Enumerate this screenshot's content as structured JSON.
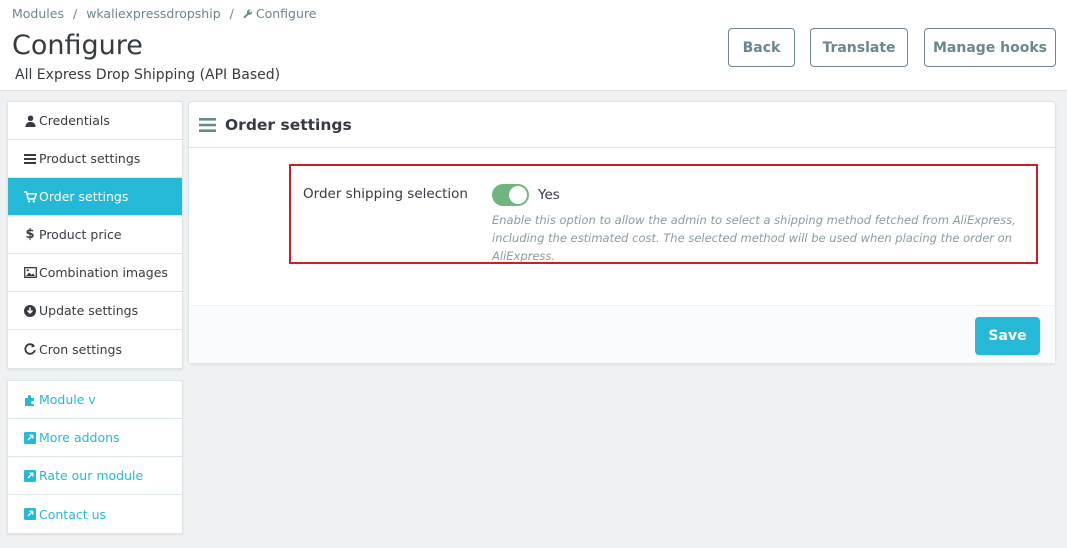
{
  "breadcrumb": {
    "items": [
      "Modules",
      "wkaliexpressdropship",
      "Configure"
    ],
    "separator": "/"
  },
  "page": {
    "title": "Configure",
    "subtitle": "All Express Drop Shipping (API Based)"
  },
  "header_buttons": {
    "back": "Back",
    "translate": "Translate",
    "manage_hooks": "Manage hooks"
  },
  "sidebar": {
    "items": [
      {
        "label": "Credentials",
        "icon": "user-icon"
      },
      {
        "label": "Product settings",
        "icon": "bars-icon"
      },
      {
        "label": "Order settings",
        "icon": "cart-icon",
        "active": true
      },
      {
        "label": "Product price",
        "icon": "dollar-icon"
      },
      {
        "label": "Combination images",
        "icon": "image-icon"
      },
      {
        "label": "Update settings",
        "icon": "download-circle-icon"
      },
      {
        "label": "Cron settings",
        "icon": "refresh-icon"
      }
    ]
  },
  "links": {
    "items": [
      {
        "label": "Module v",
        "icon": "puzzle-icon"
      },
      {
        "label": "More addons",
        "icon": "external-link-icon"
      },
      {
        "label": "Rate our module",
        "icon": "external-link-icon"
      },
      {
        "label": "Contact us",
        "icon": "external-link-icon"
      }
    ]
  },
  "panel": {
    "title": "Order settings",
    "field_label": "Order shipping selection",
    "toggle_value": "Yes",
    "toggle_on": true,
    "help_text": "Enable this option to allow the admin to select a shipping method fetched from AliExpress, including the estimated cost. The selected method will be used when placing the order on AliExpress.",
    "save_label": "Save"
  },
  "colors": {
    "accent": "#25b9d7",
    "toggle_on": "#70b580",
    "highlight_border": "#cc1f24",
    "text": "#363a41",
    "muted": "#6c868e"
  }
}
